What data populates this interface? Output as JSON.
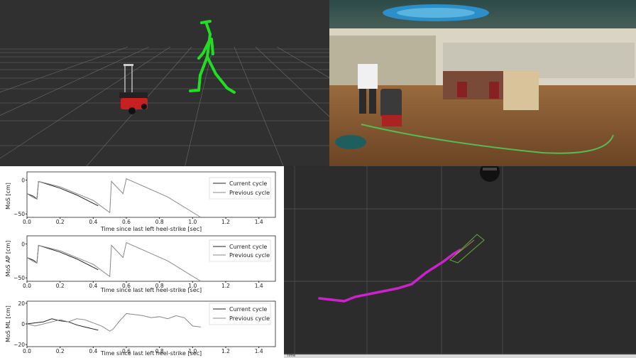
{
  "colors": {
    "skeleton": "#22dd22",
    "trajectory": "#cc22cc",
    "footprint": "#66aa33",
    "current_line": "#222222",
    "previous_line": "#888888"
  },
  "statusbar": {
    "label": "Time"
  },
  "legend": {
    "current": "Current cycle",
    "previous": "Previous cycle"
  },
  "chart_data": [
    {
      "type": "line",
      "ylabel": "MoS [cm]",
      "xlabel": "Time since last left heel-strike [sec]",
      "xlim": [
        0.0,
        1.5
      ],
      "ylim": [
        -55,
        12
      ],
      "xticks": [
        "0.0",
        "0.2",
        "0.4",
        "0.6",
        "0.8",
        "1.0",
        "1.2",
        "1.4"
      ],
      "yticks": [
        "0",
        "−50"
      ],
      "yticks_values": [
        0,
        -50
      ],
      "series": [
        {
          "name": "Current cycle",
          "x": [
            0.0,
            0.02,
            0.04,
            0.06,
            0.07,
            0.2,
            0.3,
            0.43
          ],
          "y": [
            -20,
            -22,
            -24,
            -28,
            -2,
            -12,
            -22,
            -38
          ]
        },
        {
          "name": "Previous cycle",
          "x": [
            0.0,
            0.04,
            0.06,
            0.07,
            0.2,
            0.4,
            0.5,
            0.51,
            0.58,
            0.6,
            0.85,
            1.05
          ],
          "y": [
            -20,
            -26,
            -28,
            -2,
            -10,
            -30,
            -48,
            -2,
            -20,
            2,
            -25,
            -55
          ]
        }
      ]
    },
    {
      "type": "line",
      "ylabel": "MoS AP [cm]",
      "xlabel": "Time since last left heel-strike [sec]",
      "xlim": [
        0.0,
        1.5
      ],
      "ylim": [
        -55,
        12
      ],
      "xticks": [
        "0.0",
        "0.2",
        "0.4",
        "0.6",
        "0.8",
        "1.0",
        "1.2",
        "1.4"
      ],
      "yticks": [
        "0",
        "−50"
      ],
      "yticks_values": [
        0,
        -50
      ],
      "series": [
        {
          "name": "Current cycle",
          "x": [
            0.0,
            0.02,
            0.04,
            0.06,
            0.07,
            0.2,
            0.3,
            0.43
          ],
          "y": [
            -20,
            -22,
            -24,
            -28,
            -2,
            -12,
            -22,
            -38
          ]
        },
        {
          "name": "Previous cycle",
          "x": [
            0.0,
            0.04,
            0.06,
            0.07,
            0.2,
            0.4,
            0.5,
            0.51,
            0.58,
            0.6,
            0.85,
            1.05
          ],
          "y": [
            -20,
            -26,
            -28,
            -2,
            -10,
            -30,
            -48,
            -2,
            -20,
            2,
            -25,
            -55
          ]
        }
      ]
    },
    {
      "type": "line",
      "ylabel": "MoS ML [cm]",
      "xlabel": "Time since last left heel-strike [sec]",
      "xlim": [
        0.0,
        1.5
      ],
      "ylim": [
        -22,
        22
      ],
      "xticks": [
        "0.0",
        "0.2",
        "0.4",
        "0.6",
        "0.8",
        "1.0",
        "1.2",
        "1.4"
      ],
      "yticks": [
        "20",
        "0",
        "−20"
      ],
      "yticks_values": [
        20,
        0,
        -20
      ],
      "series": [
        {
          "name": "Current cycle",
          "x": [
            0.0,
            0.05,
            0.1,
            0.15,
            0.2,
            0.25,
            0.3,
            0.35,
            0.43
          ],
          "y": [
            0,
            1,
            2,
            5,
            3,
            2,
            -1,
            -3,
            -6
          ]
        },
        {
          "name": "Previous cycle",
          "x": [
            0.0,
            0.05,
            0.1,
            0.15,
            0.2,
            0.25,
            0.3,
            0.35,
            0.4,
            0.45,
            0.5,
            0.52,
            0.56,
            0.6,
            0.65,
            0.7,
            0.75,
            0.8,
            0.85,
            0.9,
            0.95,
            1.0,
            1.05
          ],
          "y": [
            0,
            -2,
            0,
            2,
            4,
            2,
            5,
            4,
            1,
            -2,
            -7,
            -5,
            3,
            10,
            9,
            8,
            6,
            7,
            5,
            8,
            6,
            -2,
            -3
          ]
        }
      ]
    }
  ]
}
